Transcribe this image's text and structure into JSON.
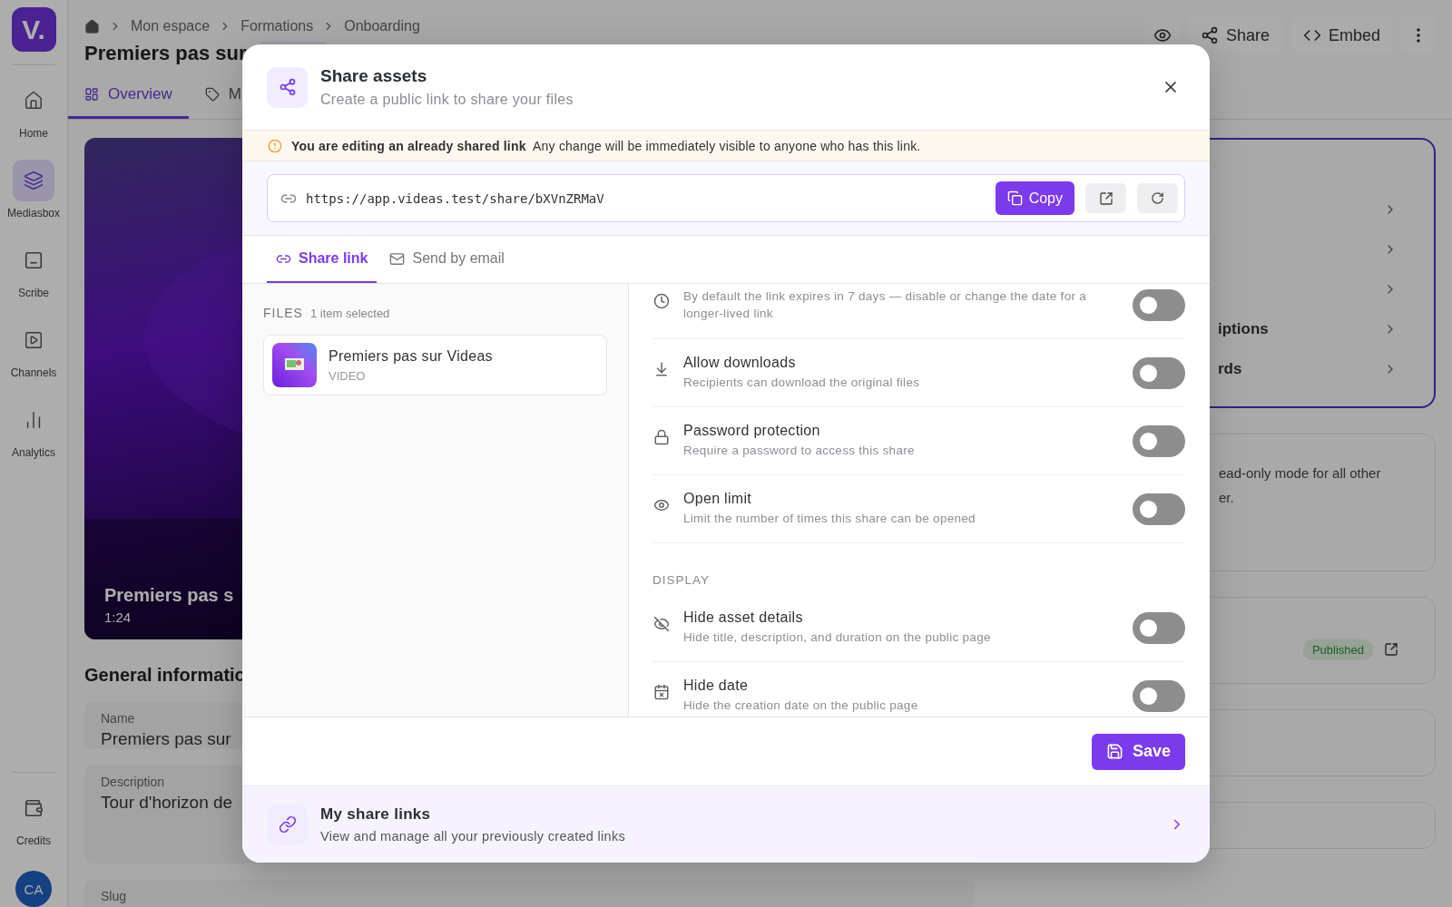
{
  "app": {
    "logo": "V.",
    "sidebar": {
      "items": [
        {
          "kind": "home",
          "label": "Home",
          "selected": false
        },
        {
          "kind": "mediasbox",
          "label": "Mediasbox",
          "selected": true
        },
        {
          "kind": "scribe",
          "label": "Scribe",
          "selected": false
        },
        {
          "kind": "channels",
          "label": "Channels",
          "selected": false
        },
        {
          "kind": "analytics",
          "label": "Analytics",
          "selected": false
        }
      ],
      "footer_items": [
        {
          "kind": "credits",
          "label": "Credits"
        }
      ],
      "avatar": "CA"
    },
    "breadcrumb": [
      "Mon espace",
      "Formations",
      "Onboarding"
    ],
    "title": "Premiers pas sur",
    "actions": [
      {
        "kind": "preview"
      },
      {
        "kind": "share",
        "label": "Share"
      },
      {
        "kind": "embed",
        "label": "Embed"
      },
      {
        "kind": "more"
      }
    ],
    "tabs": [
      {
        "kind": "overview",
        "label": "Overview",
        "selected": true
      },
      {
        "kind": "tags",
        "label": "M",
        "selected": false
      }
    ],
    "video": {
      "title": "Premiers pas s",
      "duration": "1:24"
    },
    "general": {
      "heading": "General informatio",
      "fields": [
        {
          "label": "Name",
          "value": "Premiers pas sur"
        },
        {
          "label": "Description",
          "value": "Tour d'horizon de"
        },
        {
          "label": "Slug"
        }
      ]
    },
    "nav_items": [
      {
        "kind": "hidden"
      },
      {
        "kind": "hidden"
      },
      {
        "kind": "hidden"
      },
      {
        "kind": "text",
        "label": "iptions"
      },
      {
        "kind": "text",
        "label": "rds"
      }
    ],
    "info_lines": [
      "ead-only mode for all other",
      "er."
    ],
    "status_badge": "Published"
  },
  "modal": {
    "title": "Share assets",
    "subtitle": "Create a public link to share your files",
    "alert": "**You are editing an already shared link**  Any change will be immediately visible to anyone who has this link.",
    "url": "https://app.videas.test/share/bXVnZRMaV",
    "copy_label": "Copy",
    "tabs": [
      {
        "kind": "link",
        "label": "Share link",
        "selected": true
      },
      {
        "kind": "email",
        "label": "Send by email",
        "selected": false
      }
    ],
    "files": {
      "heading": "FILES",
      "count": "1 item selected",
      "items": [
        {
          "name": "Premiers pas sur Videas",
          "type": "VIDEO",
          "kind": "picture"
        }
      ]
    },
    "sections": [
      {
        "options": [
          {
            "kind": "expiry",
            "description": "By default the link expires in 7 days — disable or change the date for a longer-lived link",
            "on": false
          },
          {
            "kind": "download",
            "title": "Allow downloads",
            "description": "Recipients can download the original files",
            "on": false
          },
          {
            "kind": "password",
            "title": "Password protection",
            "description": "Require a password to access this share",
            "on": false
          },
          {
            "kind": "limit",
            "title": "Open limit",
            "description": "Limit the number of times this share can be opened",
            "on": false
          }
        ]
      },
      {
        "heading": "DISPLAY",
        "options": [
          {
            "kind": "details",
            "title": "Hide asset details",
            "description": "Hide title, description, and duration on the public page",
            "on": false
          },
          {
            "kind": "date",
            "title": "Hide date",
            "description": "Hide the creation date on the public page",
            "on": false
          }
        ]
      }
    ],
    "save_label": "Save",
    "footer_link": {
      "title": "My share links",
      "description": "View and manage all your previously created links"
    }
  }
}
